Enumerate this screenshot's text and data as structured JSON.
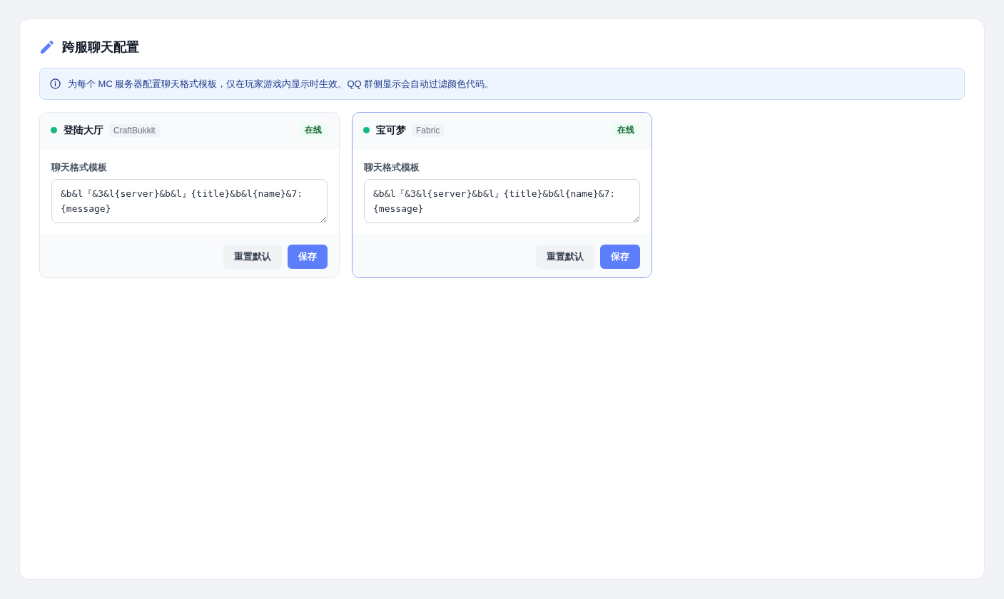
{
  "page": {
    "title": "跨服聊天配置"
  },
  "notice": {
    "text": "为每个 MC 服务器配置聊天格式模板，仅在玩家游戏内显示时生效。QQ 群侧显示会自动过滤颜色代码。"
  },
  "servers": [
    {
      "name": "登陆大厅",
      "platform": "CraftBukkit",
      "online": true,
      "status": "在线",
      "selected": false,
      "field_label": "聊天格式模板",
      "template": "&b&l『&3&l{server}&b&l』{title}&b&l{name}&7:{message}",
      "buttons": [
        {
          "label": "重置默认",
          "kind": "secondary"
        },
        {
          "label": "保存",
          "kind": "primary"
        }
      ]
    },
    {
      "name": "宝可梦",
      "platform": "Fabric",
      "online": true,
      "status": "在线",
      "selected": true,
      "field_label": "聊天格式模板",
      "template": "&b&l『&3&l{server}&b&l』{title}&b&l{name}&7:{message}",
      "buttons": [
        {
          "label": "重置默认",
          "kind": "secondary"
        },
        {
          "label": "保存",
          "kind": "primary"
        }
      ]
    }
  ]
}
